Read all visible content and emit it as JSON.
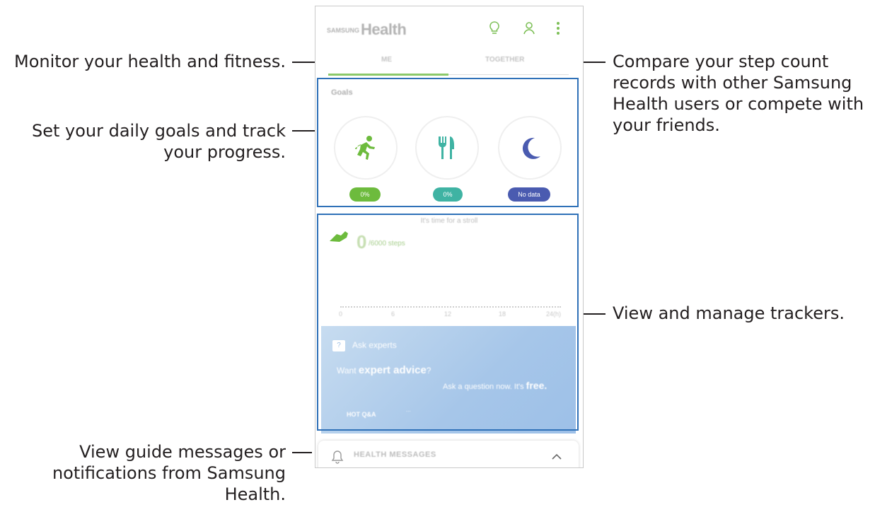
{
  "annotations": {
    "monitor": "Monitor your health and fitness.",
    "goals_line1": "Set your daily goals and track",
    "goals_line2": "your progress.",
    "compare_line1": "Compare your step count",
    "compare_line2": "records with other Samsung",
    "compare_line3": "Health users or compete with",
    "compare_line4": "your friends.",
    "trackers": "View and manage trackers.",
    "messages_line1": "View guide messages or",
    "messages_line2": "notifications from Samsung",
    "messages_line3": "Health."
  },
  "app": {
    "brand": "SAMSUNG",
    "title": "Health",
    "icons": [
      "lightbulb-icon",
      "people-icon",
      "more-vert-icon"
    ]
  },
  "tabs": [
    {
      "label": "ME",
      "active": true
    },
    {
      "label": "TOGETHER",
      "active": false
    }
  ],
  "goals": {
    "title": "Goals",
    "items": [
      {
        "icon": "running-icon",
        "badge": "0%",
        "color": "#6dbb3d"
      },
      {
        "icon": "fork-knife-icon",
        "badge": "0%",
        "color": "#3fb3a3"
      },
      {
        "icon": "moon-icon",
        "badge": "No data",
        "color": "#4a5bb0"
      }
    ]
  },
  "steps": {
    "count": "0",
    "goal": "/6000 steps",
    "message": "It's time for a stroll",
    "ticks": [
      "0",
      "6",
      "12",
      "18",
      "24(h)"
    ]
  },
  "ask_experts": {
    "title": "Ask experts",
    "line1_prefix": "Want ",
    "line1_bold": "expert advice",
    "line1_suffix": "?",
    "line2_prefix": "Ask a question now. It's ",
    "line2_bold": "free.",
    "hot_label": "HOT Q&A",
    "hot_text": "..."
  },
  "messages": {
    "label": "HEALTH MESSAGES"
  },
  "colors": {
    "frame": "#2f71b8",
    "accent_green": "#8bc96a"
  }
}
